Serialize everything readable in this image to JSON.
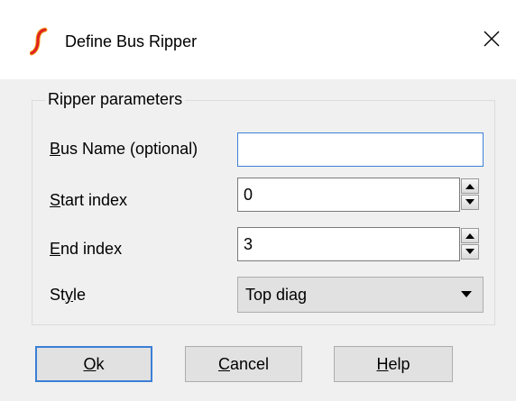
{
  "window": {
    "title": "Define Bus Ripper",
    "app_icon": "simetrix-logo-icon",
    "close_icon": "close-icon"
  },
  "group": {
    "legend": "Ripper parameters"
  },
  "fields": {
    "bus_name": {
      "label": "Bus Name (optional)",
      "mnemonic": "B",
      "label_rest": "us Name (optional)",
      "value": ""
    },
    "start_index": {
      "label": "Start index",
      "mnemonic": "S",
      "label_rest": "tart index",
      "value": "0"
    },
    "end_index": {
      "label": "End index",
      "mnemonic": "E",
      "label_rest": "nd index",
      "value": "3"
    },
    "style": {
      "label": "Style",
      "label_pre": "St",
      "mnemonic": "y",
      "label_rest": "le",
      "value": "Top diag"
    }
  },
  "buttons": {
    "ok": {
      "label": "Ok",
      "mnemonic": "O",
      "label_rest": "k"
    },
    "cancel": {
      "label": "Cancel",
      "mnemonic": "C",
      "label_rest": "ancel"
    },
    "help": {
      "label": "Help",
      "mnemonic": "H",
      "label_rest": "elp"
    }
  },
  "colors": {
    "accent_border": "#3c7fd6",
    "dialog_bg": "#f0f0f0",
    "button_bg": "#e1e1e1",
    "icon_red": "#e02020"
  }
}
